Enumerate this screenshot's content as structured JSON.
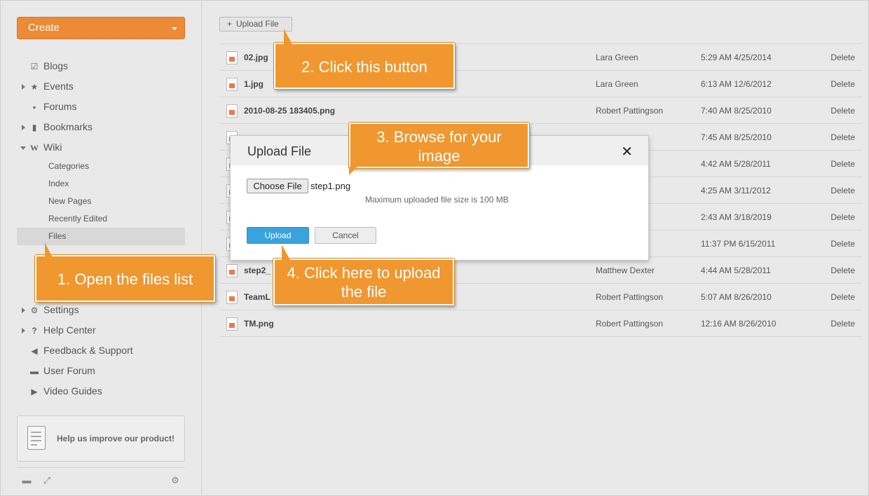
{
  "sidebar": {
    "create_label": "Create",
    "nav": [
      {
        "label": "Blogs",
        "icon": "blog-icon",
        "glyph": "☑"
      },
      {
        "label": "Events",
        "icon": "events-icon",
        "glyph": "★"
      },
      {
        "label": "Forums",
        "icon": "forums-icon",
        "glyph": "▪"
      },
      {
        "label": "Bookmarks",
        "icon": "bookmark-icon",
        "glyph": "▮"
      },
      {
        "label": "Wiki",
        "icon": "wiki-icon",
        "glyph": "W"
      }
    ],
    "wiki_sub": [
      "Categories",
      "Index",
      "New Pages",
      "Recently Edited",
      "Files"
    ],
    "nav2": [
      {
        "label": "Settings",
        "icon": "gear-icon",
        "glyph": "⚙"
      },
      {
        "label": "Help Center",
        "icon": "help-icon",
        "glyph": "?"
      },
      {
        "label": "Feedback & Support",
        "icon": "megaphone-icon",
        "glyph": "◀"
      },
      {
        "label": "User Forum",
        "icon": "forum-icon",
        "glyph": "▬"
      },
      {
        "label": "Video Guides",
        "icon": "video-icon",
        "glyph": "▶"
      }
    ],
    "improve_label": "Help us improve our product!"
  },
  "toolbar": {
    "upload_label": "Upload File",
    "upload_plus": "+"
  },
  "files": [
    {
      "name": "02.jpg",
      "author": "Lara Green",
      "date": "5:29 AM 4/25/2014",
      "action": "Delete"
    },
    {
      "name": "1.jpg",
      "author": "Lara Green",
      "date": "6:13 AM 12/6/2012",
      "action": "Delete"
    },
    {
      "name": "2010-08-25 183405.png",
      "author": "Robert Pattingson",
      "date": "7:40 AM 8/25/2010",
      "action": "Delete"
    },
    {
      "name": "",
      "author": "",
      "date": "7:45 AM 8/25/2010",
      "action": "Delete"
    },
    {
      "name": "",
      "author": "",
      "date": "4:42 AM 5/28/2011",
      "action": "Delete"
    },
    {
      "name": "",
      "author": "",
      "date": "4:25 AM 3/11/2012",
      "action": "Delete"
    },
    {
      "name": "",
      "author": "",
      "date": "2:43 AM 3/18/2019",
      "action": "Delete"
    },
    {
      "name": "",
      "author": "",
      "date": "11:37 PM 6/15/2011",
      "action": "Delete"
    },
    {
      "name": "step2_",
      "author": "Matthew Dexter",
      "date": "4:44 AM 5/28/2011",
      "action": "Delete"
    },
    {
      "name": "TeamL",
      "author": "Robert Pattingson",
      "date": "5:07 AM 8/26/2010",
      "action": "Delete"
    },
    {
      "name": "TM.png",
      "author": "Robert Pattingson",
      "date": "12:16 AM 8/26/2010",
      "action": "Delete"
    }
  ],
  "dialog": {
    "title": "Upload File",
    "close": "✕",
    "choose_label": "Choose File",
    "chosen_file": "step1.png",
    "max_size": "Maximum uploaded file size is 100 MB",
    "upload_label": "Upload",
    "cancel_label": "Cancel"
  },
  "callouts": {
    "c1": "1. Open the files list",
    "c2": "2. Click this button",
    "c3_line1": "3. Browse for your",
    "c3_line2": "image",
    "c4_line1": "4. Click here to upload",
    "c4_line2": "the file"
  },
  "footer": {
    "chat_icon": "chat-icon",
    "expand_icon": "expand-icon",
    "settings_icon": "gear-icon"
  },
  "colors": {
    "accent": "#ec8a35",
    "callout": "#f0972f",
    "primary_button": "#3aa3dd"
  }
}
